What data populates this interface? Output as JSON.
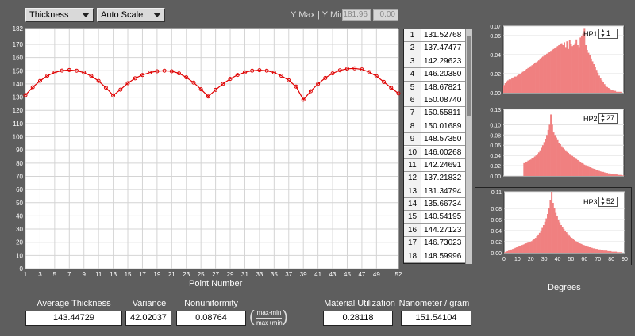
{
  "toolbar": {
    "measure_select": "Thickness",
    "scale_select": "Auto Scale",
    "ymaxmin_label": "Y Max | Y Min",
    "ymax": "181.96",
    "ymin": "0.00"
  },
  "chart_data": [
    {
      "type": "line",
      "xlabel": "Point Number",
      "ylabel": "",
      "xlim": [
        1,
        52
      ],
      "ylim": [
        0,
        182
      ],
      "x_ticks": [
        1,
        3,
        5,
        7,
        9,
        11,
        13,
        15,
        17,
        19,
        21,
        23,
        25,
        27,
        29,
        31,
        33,
        35,
        37,
        39,
        41,
        43,
        45,
        47,
        49,
        52
      ],
      "y_ticks": [
        0,
        10,
        20,
        30,
        40,
        50,
        60,
        70,
        80,
        90,
        100,
        110,
        120,
        130,
        140,
        150,
        160,
        170,
        182
      ],
      "grid": true,
      "series": [
        {
          "color": "#e00000",
          "x": [
            1,
            2,
            3,
            4,
            5,
            6,
            7,
            8,
            9,
            10,
            11,
            12,
            13,
            14,
            15,
            16,
            17,
            18,
            19,
            20,
            21,
            22,
            23,
            24,
            25,
            26,
            27,
            28,
            29,
            30,
            31,
            32,
            33,
            34,
            35,
            36,
            37,
            38,
            39,
            40,
            41,
            42,
            43,
            44,
            45,
            46,
            47,
            48,
            49,
            50,
            51,
            52
          ],
          "values": [
            131.53,
            137.47,
            142.3,
            146.2,
            148.68,
            150.09,
            150.56,
            150.02,
            148.57,
            146.0,
            142.25,
            137.22,
            131.35,
            135.67,
            140.54,
            144.27,
            146.73,
            148.6,
            149.6,
            150.0,
            149.6,
            148.0,
            145.0,
            141.0,
            136.0,
            130.5,
            135.5,
            140.0,
            143.8,
            146.8,
            148.8,
            150.0,
            150.4,
            150.0,
            148.6,
            146.2,
            142.7,
            138.0,
            128.0,
            134.5,
            140.0,
            144.5,
            148.0,
            150.3,
            151.5,
            151.8,
            151.0,
            149.0,
            145.8,
            141.5,
            137.0,
            132.8
          ]
        }
      ]
    },
    {
      "type": "bar",
      "name": "HP1",
      "xlabel": "",
      "xlim": [
        0,
        90
      ],
      "ylim": [
        0,
        0.07
      ],
      "y_ticks": [
        "0.00",
        "0.02",
        "0.04",
        "0.06",
        "0.07"
      ],
      "color": "#f08080",
      "values": [
        0.008,
        0.01,
        0.012,
        0.013,
        0.014,
        0.014,
        0.015,
        0.016,
        0.017,
        0.017,
        0.018,
        0.019,
        0.02,
        0.021,
        0.022,
        0.023,
        0.024,
        0.025,
        0.026,
        0.027,
        0.028,
        0.029,
        0.03,
        0.031,
        0.032,
        0.033,
        0.034,
        0.036,
        0.037,
        0.038,
        0.039,
        0.04,
        0.041,
        0.042,
        0.043,
        0.044,
        0.045,
        0.046,
        0.047,
        0.048,
        0.049,
        0.05,
        0.051,
        0.052,
        0.05,
        0.053,
        0.048,
        0.054,
        0.046,
        0.055,
        0.051,
        0.049,
        0.05,
        0.052,
        0.056,
        0.05,
        0.048,
        0.058,
        0.06,
        0.062,
        0.068,
        0.05,
        0.045,
        0.042,
        0.04,
        0.036,
        0.033,
        0.03,
        0.027,
        0.024,
        0.021,
        0.018,
        0.015,
        0.013,
        0.011,
        0.009,
        0.007,
        0.006,
        0.005,
        0.004,
        0.003,
        0.003,
        0.002,
        0.002,
        0.001,
        0.001,
        0.001,
        0.001,
        0.0,
        0.0
      ]
    },
    {
      "type": "bar",
      "name": "HP2",
      "xlabel": "",
      "xlim": [
        0,
        90
      ],
      "ylim": [
        0,
        0.13
      ],
      "y_ticks": [
        "0.00",
        "0.02",
        "0.04",
        "0.06",
        "0.08",
        "0.10",
        "0.13"
      ],
      "color": "#f08080",
      "values": [
        0,
        0,
        0,
        0,
        0,
        0,
        0,
        0,
        0,
        0,
        0,
        0,
        0,
        0,
        0,
        0.025,
        0.027,
        0.028,
        0.03,
        0.031,
        0.032,
        0.034,
        0.036,
        0.038,
        0.04,
        0.043,
        0.046,
        0.05,
        0.055,
        0.06,
        0.066,
        0.072,
        0.08,
        0.09,
        0.1,
        0.12,
        0.1,
        0.085,
        0.08,
        0.075,
        0.07,
        0.065,
        0.062,
        0.058,
        0.055,
        0.052,
        0.05,
        0.047,
        0.045,
        0.043,
        0.041,
        0.039,
        0.037,
        0.035,
        0.033,
        0.031,
        0.029,
        0.027,
        0.025,
        0.024,
        0.022,
        0.021,
        0.02,
        0.018,
        0.017,
        0.016,
        0.015,
        0.014,
        0.013,
        0.012,
        0.011,
        0.01,
        0.009,
        0.008,
        0.008,
        0.007,
        0.006,
        0.006,
        0.005,
        0.005,
        0.004,
        0.004,
        0.003,
        0.003,
        0.003,
        0.002,
        0.002,
        0.002,
        0.001,
        0.001
      ]
    },
    {
      "type": "bar",
      "name": "HP3",
      "xlabel": "Degrees",
      "xlim": [
        0,
        90
      ],
      "x_ticks": [
        0,
        10,
        20,
        30,
        40,
        50,
        60,
        70,
        80,
        90
      ],
      "ylim": [
        0,
        0.11
      ],
      "y_ticks": [
        "0.00",
        "0.02",
        "0.04",
        "0.06",
        "0.08",
        "0.11"
      ],
      "color": "#f08080",
      "values": [
        0.001,
        0.002,
        0.003,
        0.004,
        0.005,
        0.006,
        0.007,
        0.008,
        0.009,
        0.01,
        0.011,
        0.012,
        0.013,
        0.014,
        0.015,
        0.016,
        0.017,
        0.018,
        0.019,
        0.02,
        0.021,
        0.023,
        0.025,
        0.027,
        0.03,
        0.033,
        0.036,
        0.04,
        0.045,
        0.05,
        0.056,
        0.062,
        0.07,
        0.08,
        0.095,
        0.11,
        0.09,
        0.08,
        0.072,
        0.066,
        0.06,
        0.055,
        0.05,
        0.046,
        0.043,
        0.04,
        0.037,
        0.034,
        0.031,
        0.029,
        0.027,
        0.025,
        0.023,
        0.021,
        0.019,
        0.018,
        0.017,
        0.016,
        0.015,
        0.014,
        0.013,
        0.012,
        0.011,
        0.01,
        0.01,
        0.009,
        0.008,
        0.008,
        0.007,
        0.007,
        0.006,
        0.006,
        0.005,
        0.005,
        0.004,
        0.004,
        0.004,
        0.003,
        0.003,
        0.003,
        0.002,
        0.002,
        0.002,
        0.002,
        0.001,
        0.001,
        0.001,
        0.001,
        0.0,
        0.0
      ]
    }
  ],
  "point_list": [
    {
      "idx": "1",
      "value": "131.52768"
    },
    {
      "idx": "2",
      "value": "137.47477"
    },
    {
      "idx": "3",
      "value": "142.29623"
    },
    {
      "idx": "4",
      "value": "146.20380"
    },
    {
      "idx": "5",
      "value": "148.67821"
    },
    {
      "idx": "6",
      "value": "150.08740"
    },
    {
      "idx": "7",
      "value": "150.55811"
    },
    {
      "idx": "8",
      "value": "150.01689"
    },
    {
      "idx": "9",
      "value": "148.57350"
    },
    {
      "idx": "10",
      "value": "146.00268"
    },
    {
      "idx": "11",
      "value": "142.24691"
    },
    {
      "idx": "12",
      "value": "137.21832"
    },
    {
      "idx": "13",
      "value": "131.34794"
    },
    {
      "idx": "14",
      "value": "135.66734"
    },
    {
      "idx": "15",
      "value": "140.54195"
    },
    {
      "idx": "16",
      "value": "144.27123"
    },
    {
      "idx": "17",
      "value": "146.73023"
    },
    {
      "idx": "18",
      "value": "148.59996"
    }
  ],
  "histograms": {
    "hp1": {
      "label": "HP1",
      "value": "1"
    },
    "hp2": {
      "label": "HP2",
      "value": "27"
    },
    "hp3": {
      "label": "HP3",
      "value": "52"
    },
    "xlabel": "Degrees"
  },
  "stats": {
    "avg_label": "Average Thickness",
    "avg_value": "143.44729",
    "var_label": "Variance",
    "var_value": "42.02037",
    "nonu_label": "Nonuniformity",
    "nonu_value": "0.08764",
    "formula_num": "max-min",
    "formula_den": "max+min",
    "mat_label": "Material Utilization",
    "mat_value": "0.28118",
    "nm_label": "Nanometer / gram",
    "nm_value": "151.54104"
  },
  "colors": {
    "series": "#e00000",
    "hist": "#f08080",
    "panel": "#5e5e5e",
    "plot_bg": "#ffffff"
  }
}
